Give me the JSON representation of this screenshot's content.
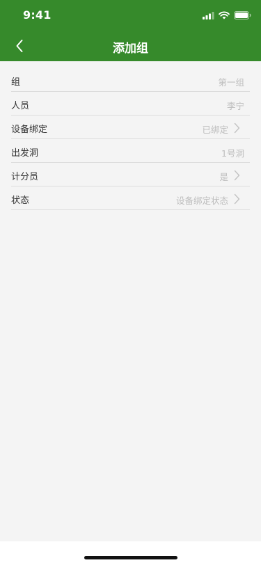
{
  "status_bar": {
    "time": "9:41"
  },
  "nav": {
    "title": "添加组",
    "back_icon": "chevron-left-icon"
  },
  "form": {
    "rows": [
      {
        "label": "组",
        "value": "第一组",
        "has_arrow": false
      },
      {
        "label": "人员",
        "value": "李宁",
        "has_arrow": false
      },
      {
        "label": "设备绑定",
        "value": "已绑定",
        "has_arrow": true
      },
      {
        "label": "出发洞",
        "value": "1号洞",
        "has_arrow": false
      },
      {
        "label": "计分员",
        "value": "是",
        "has_arrow": true
      },
      {
        "label": "状态",
        "value": "设备绑定状态",
        "has_arrow": true
      }
    ]
  },
  "colors": {
    "header_bg": "#368a2b",
    "page_bg": "#f4f4f4",
    "label_text": "#333333",
    "value_text": "#bdbdbd",
    "divider": "#dcdcdc"
  }
}
